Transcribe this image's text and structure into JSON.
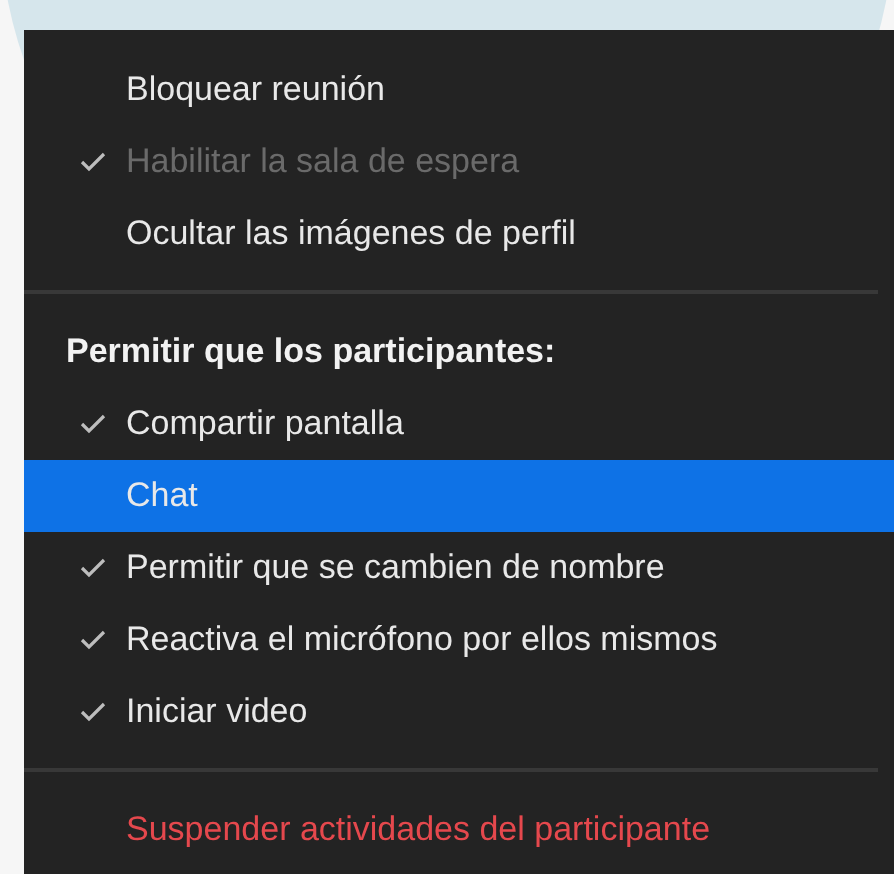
{
  "menu": {
    "sections": [
      {
        "items": [
          {
            "kind": "option",
            "label": "Bloquear reunión",
            "checked": false,
            "disabled": false,
            "selected": false
          },
          {
            "kind": "option",
            "label": "Habilitar la sala de espera",
            "checked": true,
            "disabled": true,
            "selected": false
          },
          {
            "kind": "option",
            "label": "Ocultar las imágenes de perfil",
            "checked": false,
            "disabled": false,
            "selected": false
          }
        ]
      },
      {
        "items": [
          {
            "kind": "header",
            "label": "Permitir que los participantes:"
          },
          {
            "kind": "option",
            "label": "Compartir pantalla",
            "checked": true,
            "disabled": false,
            "selected": false
          },
          {
            "kind": "option",
            "label": "Chat",
            "checked": false,
            "disabled": false,
            "selected": true
          },
          {
            "kind": "option",
            "label": "Permitir que se cambien de nombre",
            "checked": true,
            "disabled": false,
            "selected": false
          },
          {
            "kind": "option",
            "label": "Reactiva el micrófono por ellos mismos",
            "checked": true,
            "disabled": false,
            "selected": false
          },
          {
            "kind": "option",
            "label": "Iniciar video",
            "checked": true,
            "disabled": false,
            "selected": false
          }
        ]
      },
      {
        "items": [
          {
            "kind": "danger",
            "label": "Suspender actividades del participante"
          }
        ]
      }
    ]
  }
}
